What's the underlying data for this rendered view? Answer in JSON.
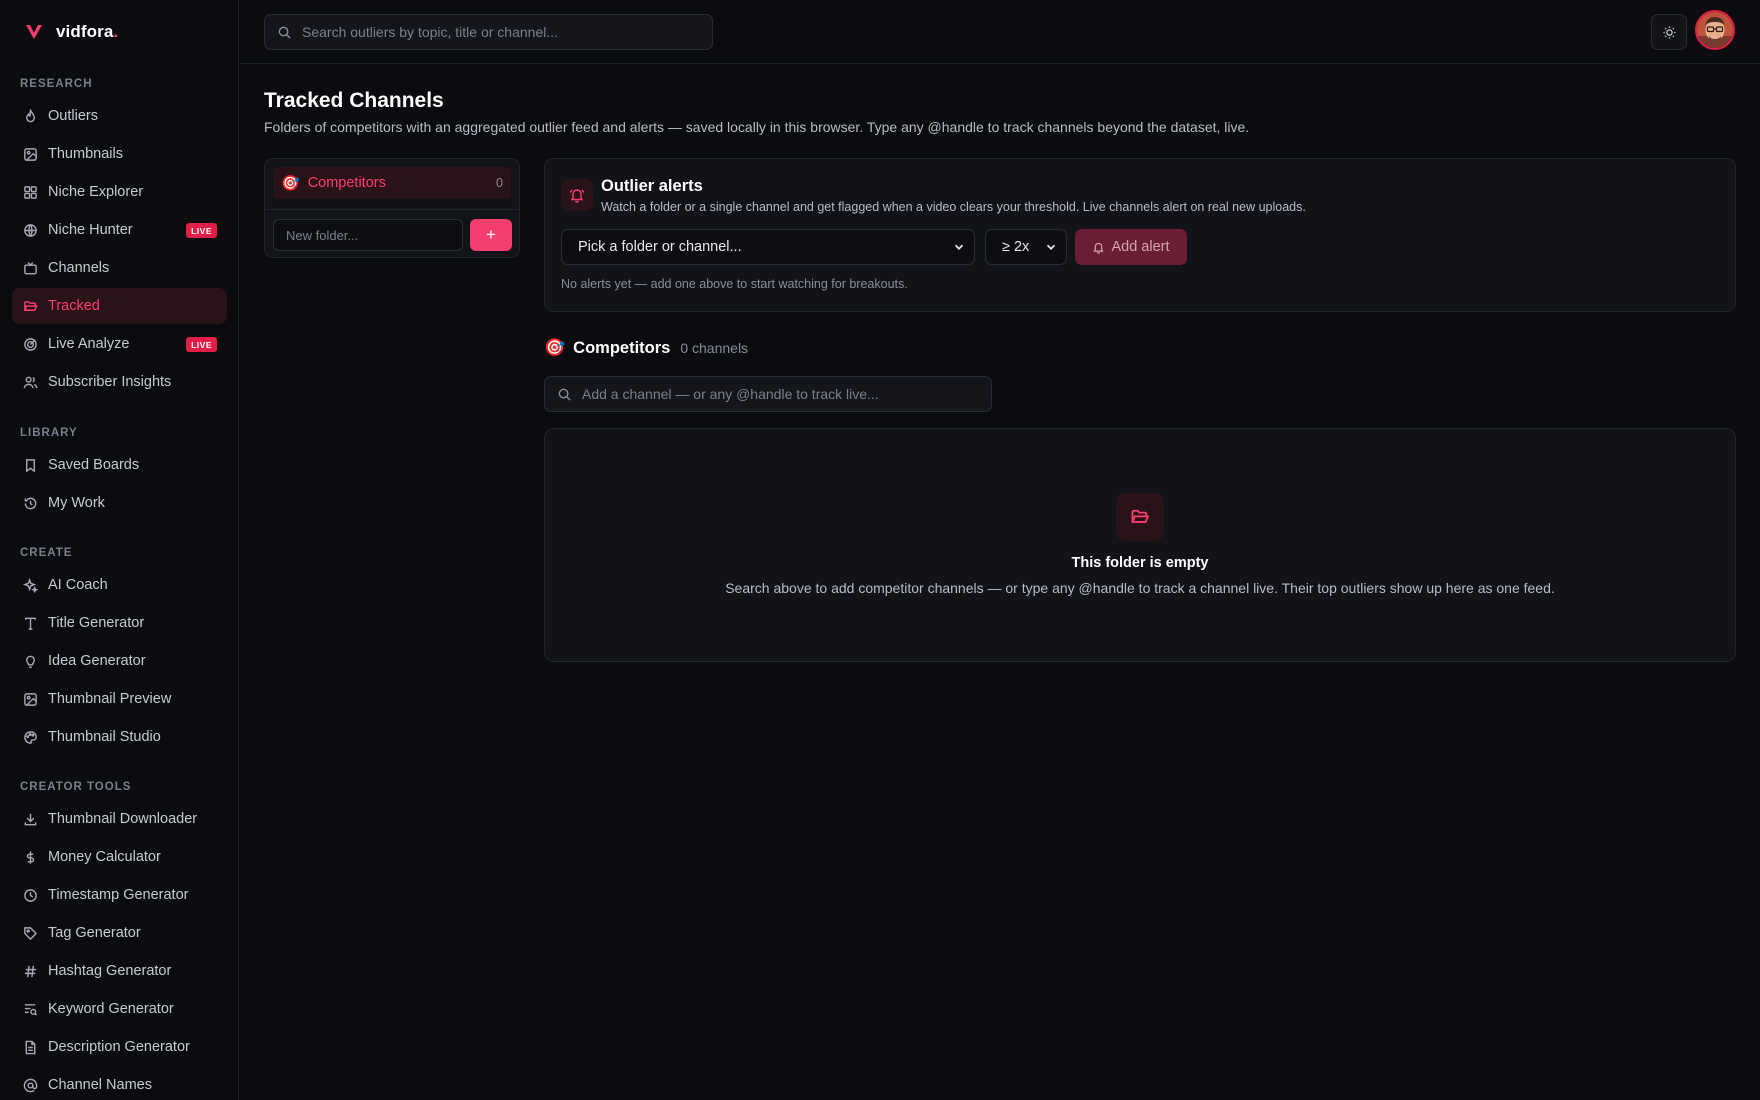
{
  "brand": {
    "name": "vidfora",
    "dot": ".",
    "accent": "#ff3d6e"
  },
  "sidebar": {
    "sections": [
      {
        "label": "RESEARCH"
      },
      {
        "label": "LIBRARY"
      },
      {
        "label": "CREATE"
      },
      {
        "label": "CREATOR TOOLS"
      }
    ],
    "items": [
      {
        "label": "Outliers",
        "icon": "flame-icon"
      },
      {
        "label": "Thumbnails",
        "icon": "image-icon"
      },
      {
        "label": "Niche Explorer",
        "icon": "grid-icon"
      },
      {
        "label": "Niche Hunter",
        "icon": "globe-icon",
        "badge": "LIVE"
      },
      {
        "label": "Channels",
        "icon": "tv-icon"
      },
      {
        "label": "Tracked",
        "icon": "folder-open-icon",
        "active": true
      },
      {
        "label": "Live Analyze",
        "icon": "radar-icon",
        "badge": "LIVE"
      },
      {
        "label": "Subscriber Insights",
        "icon": "users-icon"
      },
      {
        "label": "Saved Boards",
        "icon": "bookmark-icon"
      },
      {
        "label": "My Work",
        "icon": "history-icon"
      },
      {
        "label": "AI Coach",
        "icon": "sparkles-icon"
      },
      {
        "label": "Title Generator",
        "icon": "type-icon"
      },
      {
        "label": "Idea Generator",
        "icon": "lightbulb-icon"
      },
      {
        "label": "Thumbnail Preview",
        "icon": "image-icon"
      },
      {
        "label": "Thumbnail Studio",
        "icon": "palette-icon"
      },
      {
        "label": "Thumbnail Downloader",
        "icon": "download-icon"
      },
      {
        "label": "Money Calculator",
        "icon": "dollar-icon"
      },
      {
        "label": "Timestamp Generator",
        "icon": "clock-icon"
      },
      {
        "label": "Tag Generator",
        "icon": "tag-icon"
      },
      {
        "label": "Hashtag Generator",
        "icon": "hash-icon"
      },
      {
        "label": "Keyword Generator",
        "icon": "text-search-icon"
      },
      {
        "label": "Description Generator",
        "icon": "file-text-icon"
      },
      {
        "label": "Channel Names",
        "icon": "at-sign-icon"
      }
    ]
  },
  "topbar": {
    "search_placeholder": "Search outliers by topic, title or channel...",
    "theme_icon": "sun-icon"
  },
  "page": {
    "title": "Tracked Channels",
    "subtitle": "Folders of competitors with an aggregated outlier feed and alerts — saved locally in this browser. Type any @handle to track channels beyond the dataset, live."
  },
  "folders": {
    "items": [
      {
        "emoji": "🎯",
        "name": "Competitors",
        "count": "0"
      }
    ],
    "new_folder_placeholder": "New folder...",
    "add_label": "+"
  },
  "alerts": {
    "title": "Outlier alerts",
    "description": "Watch a folder or a single channel and get flagged when a video clears your threshold. Live channels alert on real new uploads.",
    "target_select": "Pick a folder or channel...",
    "threshold_select": "≥ 2x",
    "add_button": "Add alert",
    "empty": "No alerts yet — add one above to start watching for breakouts."
  },
  "folder_view": {
    "emoji": "🎯",
    "name": "Competitors",
    "count_label": "0 channels",
    "search_placeholder": "Add a channel — or any @handle to track live...",
    "empty_title": "This folder is empty",
    "empty_description": "Search above to add competitor channels — or type any @handle to track a channel live. Their top outliers show up here as one feed."
  }
}
